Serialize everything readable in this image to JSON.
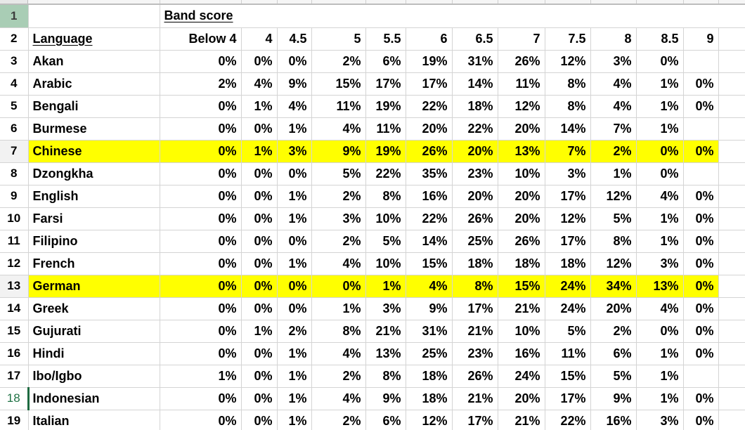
{
  "sheet": {
    "band_score_label": "Band score",
    "language_header": "Language",
    "band_columns": [
      "Below 4",
      "4",
      "4.5",
      "5",
      "5.5",
      "6",
      "6.5",
      "7",
      "7.5",
      "8",
      "8.5",
      "9"
    ],
    "highlight_color": "#ffff00",
    "active_row_color": "#217346",
    "selected_header_color": "#a9cdb5",
    "row_numbers": [
      "1",
      "2",
      "3",
      "4",
      "5",
      "6",
      "7",
      "8",
      "9",
      "10",
      "11",
      "12",
      "13",
      "14",
      "15",
      "16",
      "17",
      "18",
      "19"
    ],
    "rows": [
      {
        "row_number": "3",
        "language": "Akan",
        "values": [
          "0%",
          "0%",
          "0%",
          "2%",
          "6%",
          "19%",
          "31%",
          "26%",
          "12%",
          "3%",
          "0%",
          ""
        ],
        "highlighted": false,
        "active": false
      },
      {
        "row_number": "4",
        "language": "Arabic",
        "values": [
          "2%",
          "4%",
          "9%",
          "15%",
          "17%",
          "17%",
          "14%",
          "11%",
          "8%",
          "4%",
          "1%",
          "0%"
        ],
        "highlighted": false,
        "active": false
      },
      {
        "row_number": "5",
        "language": "Bengali",
        "values": [
          "0%",
          "1%",
          "4%",
          "11%",
          "19%",
          "22%",
          "18%",
          "12%",
          "8%",
          "4%",
          "1%",
          "0%"
        ],
        "highlighted": false,
        "active": false
      },
      {
        "row_number": "6",
        "language": "Burmese",
        "values": [
          "0%",
          "0%",
          "1%",
          "4%",
          "11%",
          "20%",
          "22%",
          "20%",
          "14%",
          "7%",
          "1%",
          ""
        ],
        "highlighted": false,
        "active": false
      },
      {
        "row_number": "7",
        "language": "Chinese",
        "values": [
          "0%",
          "1%",
          "3%",
          "9%",
          "19%",
          "26%",
          "20%",
          "13%",
          "7%",
          "2%",
          "0%",
          "0%"
        ],
        "highlighted": true,
        "active": false
      },
      {
        "row_number": "8",
        "language": "Dzongkha",
        "values": [
          "0%",
          "0%",
          "0%",
          "5%",
          "22%",
          "35%",
          "23%",
          "10%",
          "3%",
          "1%",
          "0%",
          ""
        ],
        "highlighted": false,
        "active": false
      },
      {
        "row_number": "9",
        "language": "English",
        "values": [
          "0%",
          "0%",
          "1%",
          "2%",
          "8%",
          "16%",
          "20%",
          "20%",
          "17%",
          "12%",
          "4%",
          "0%"
        ],
        "highlighted": false,
        "active": false
      },
      {
        "row_number": "10",
        "language": "Farsi",
        "values": [
          "0%",
          "0%",
          "1%",
          "3%",
          "10%",
          "22%",
          "26%",
          "20%",
          "12%",
          "5%",
          "1%",
          "0%"
        ],
        "highlighted": false,
        "active": false
      },
      {
        "row_number": "11",
        "language": "Filipino",
        "values": [
          "0%",
          "0%",
          "0%",
          "2%",
          "5%",
          "14%",
          "25%",
          "26%",
          "17%",
          "8%",
          "1%",
          "0%"
        ],
        "highlighted": false,
        "active": false
      },
      {
        "row_number": "12",
        "language": "French",
        "values": [
          "0%",
          "0%",
          "1%",
          "4%",
          "10%",
          "15%",
          "18%",
          "18%",
          "18%",
          "12%",
          "3%",
          "0%"
        ],
        "highlighted": false,
        "active": false
      },
      {
        "row_number": "13",
        "language": "German",
        "values": [
          "0%",
          "0%",
          "0%",
          "0%",
          "1%",
          "4%",
          "8%",
          "15%",
          "24%",
          "34%",
          "13%",
          "0%"
        ],
        "highlighted": true,
        "active": false
      },
      {
        "row_number": "14",
        "language": "Greek",
        "values": [
          "0%",
          "0%",
          "0%",
          "1%",
          "3%",
          "9%",
          "17%",
          "21%",
          "24%",
          "20%",
          "4%",
          "0%"
        ],
        "highlighted": false,
        "active": false
      },
      {
        "row_number": "15",
        "language": "Gujurati",
        "values": [
          "0%",
          "1%",
          "2%",
          "8%",
          "21%",
          "31%",
          "21%",
          "10%",
          "5%",
          "2%",
          "0%",
          "0%"
        ],
        "highlighted": false,
        "active": false
      },
      {
        "row_number": "16",
        "language": "Hindi",
        "values": [
          "0%",
          "0%",
          "1%",
          "4%",
          "13%",
          "25%",
          "23%",
          "16%",
          "11%",
          "6%",
          "1%",
          "0%"
        ],
        "highlighted": false,
        "active": false
      },
      {
        "row_number": "17",
        "language": "Ibo/Igbo",
        "values": [
          "1%",
          "0%",
          "1%",
          "2%",
          "8%",
          "18%",
          "26%",
          "24%",
          "15%",
          "5%",
          "1%",
          ""
        ],
        "highlighted": false,
        "active": false
      },
      {
        "row_number": "18",
        "language": "Indonesian",
        "values": [
          "0%",
          "0%",
          "1%",
          "4%",
          "9%",
          "18%",
          "21%",
          "20%",
          "17%",
          "9%",
          "1%",
          "0%"
        ],
        "highlighted": false,
        "active": true
      },
      {
        "row_number": "19",
        "language": "Italian",
        "values": [
          "0%",
          "0%",
          "1%",
          "2%",
          "6%",
          "12%",
          "17%",
          "21%",
          "22%",
          "16%",
          "3%",
          "0%"
        ],
        "highlighted": false,
        "active": false
      }
    ]
  }
}
